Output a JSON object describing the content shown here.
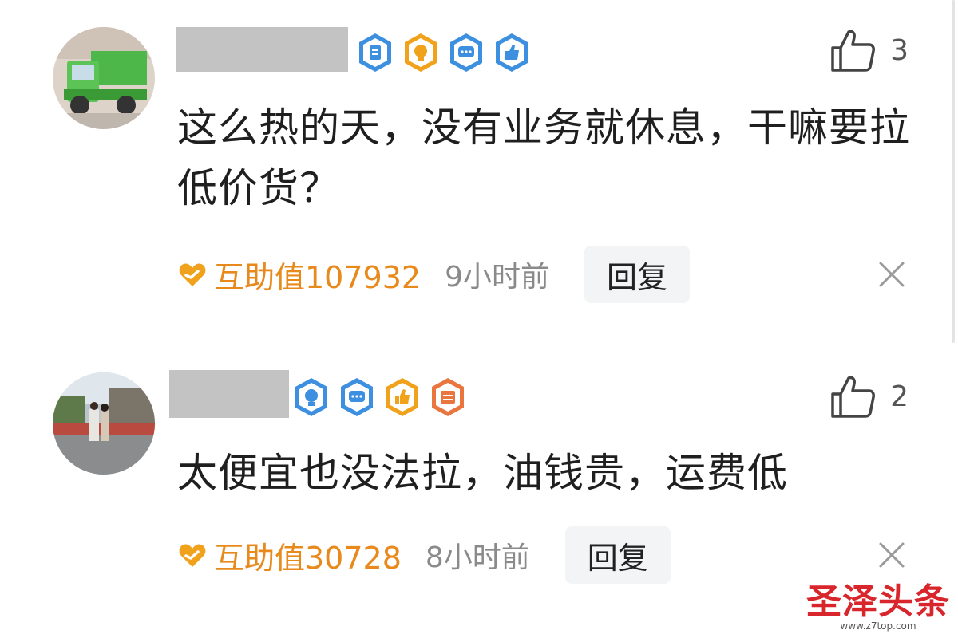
{
  "comments": [
    {
      "avatar": "dump-truck-photo",
      "badges": [
        "note-badge",
        "lightbulb-badge",
        "chat-badge",
        "thumbs-up-badge"
      ],
      "like_count": "3",
      "text": "这么热的天，没有业务就休息，干嘛要拉低价货？",
      "help_value": "互助值107932",
      "time": "9小时前",
      "reply_label": "回复"
    },
    {
      "avatar": "people-outdoor-photo",
      "badges": [
        "lightbulb-badge",
        "chat-badge",
        "thumbs-up-badge",
        "note-badge"
      ],
      "like_count": "2",
      "text": "太便宜也没法拉，油钱贵，运费低",
      "help_value": "互助值30728",
      "time": "8小时前",
      "reply_label": "回复"
    }
  ],
  "watermark": {
    "main": "圣泽头条",
    "sub": "www.z7top.com"
  },
  "colors": {
    "badge_blue": "#3d8fe0",
    "badge_orange": "#f0a21c",
    "help_orange": "#e8891c",
    "reply_bg": "#f2f4f6",
    "watermark_red": "#d8262c"
  }
}
